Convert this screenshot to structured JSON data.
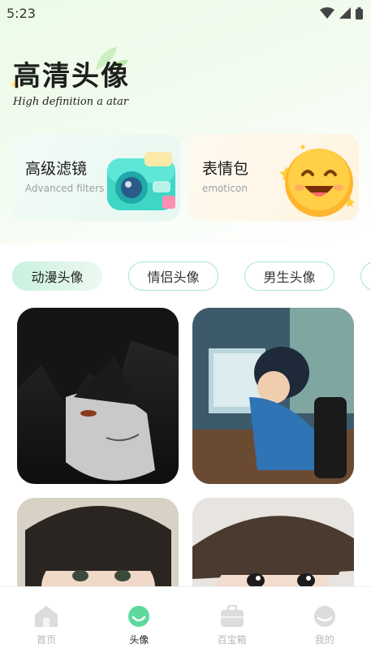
{
  "status_bar": {
    "time": "5:23"
  },
  "hero": {
    "title": "高清头像",
    "subtitle": "High definition a atar"
  },
  "cards": [
    {
      "title": "高级滤镜",
      "subtitle": "Advanced filters",
      "icon": "camera-icon"
    },
    {
      "title": "表情包",
      "subtitle": "emoticon",
      "icon": "smile-emoji-icon"
    }
  ],
  "tabs": [
    "动漫头像",
    "情侣头像",
    "男生头像",
    ""
  ],
  "avatars": [
    {
      "name": "dark-anime-boy-avatar"
    },
    {
      "name": "anime-boy-computer-avatar"
    },
    {
      "name": "anime-boy-brown-hair-avatar"
    },
    {
      "name": "anime-boy-surprised-avatar"
    }
  ],
  "nav": [
    {
      "label": "首页",
      "icon": "home-icon",
      "active": false
    },
    {
      "label": "头像",
      "icon": "smile-icon",
      "active": true
    },
    {
      "label": "百宝箱",
      "icon": "toolbox-icon",
      "active": false
    },
    {
      "label": "我的",
      "icon": "profile-icon",
      "active": false
    }
  ],
  "colors": {
    "accent": "#5fd99b",
    "tab_border": "#a9e6cd",
    "nav_inactive": "#b9b9b9"
  }
}
